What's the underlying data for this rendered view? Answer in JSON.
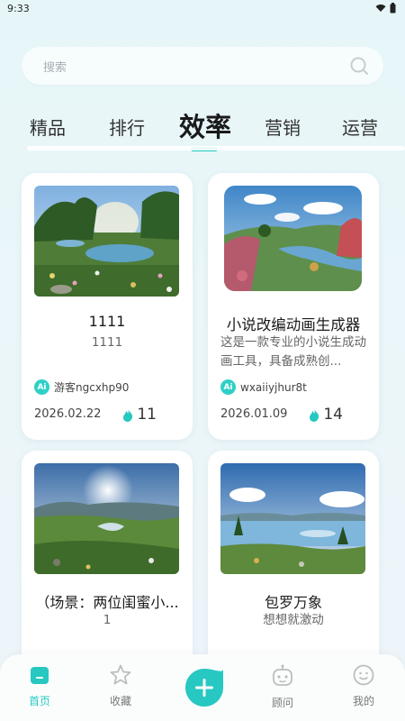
{
  "status": {
    "time": "9:33"
  },
  "search": {
    "placeholder": "搜索"
  },
  "tabs": [
    {
      "label": "精品"
    },
    {
      "label": "排行"
    },
    {
      "label": "效率",
      "active": true
    },
    {
      "label": "营销"
    },
    {
      "label": "运营"
    }
  ],
  "cards": [
    {
      "title": "1111",
      "desc": "1111",
      "author": "游客ngcxhp90",
      "date": "2026.02.22",
      "hot": "11"
    },
    {
      "title": "小说改编动画生成器",
      "desc": "这是一款专业的小说生成动画工具，具备成熟创...",
      "author": "wxaiiyjhur8t",
      "date": "2026.01.09",
      "hot": "14"
    },
    {
      "title": "（场景：两位闺蜜小...",
      "desc": "1"
    },
    {
      "title": "包罗万象",
      "desc": "想想就激动"
    }
  ],
  "badges": {
    "ai": "Ai"
  },
  "nav": [
    {
      "label": "首页",
      "icon": "home-icon",
      "active": true
    },
    {
      "label": "收藏",
      "icon": "star-icon"
    },
    {
      "label": "",
      "icon": "add-icon"
    },
    {
      "label": "顾问",
      "icon": "robot-icon"
    },
    {
      "label": "我的",
      "icon": "smiley-icon"
    }
  ],
  "colors": {
    "accent": "#27c8c1",
    "background": "#e9f6f8",
    "card": "#ffffff"
  }
}
